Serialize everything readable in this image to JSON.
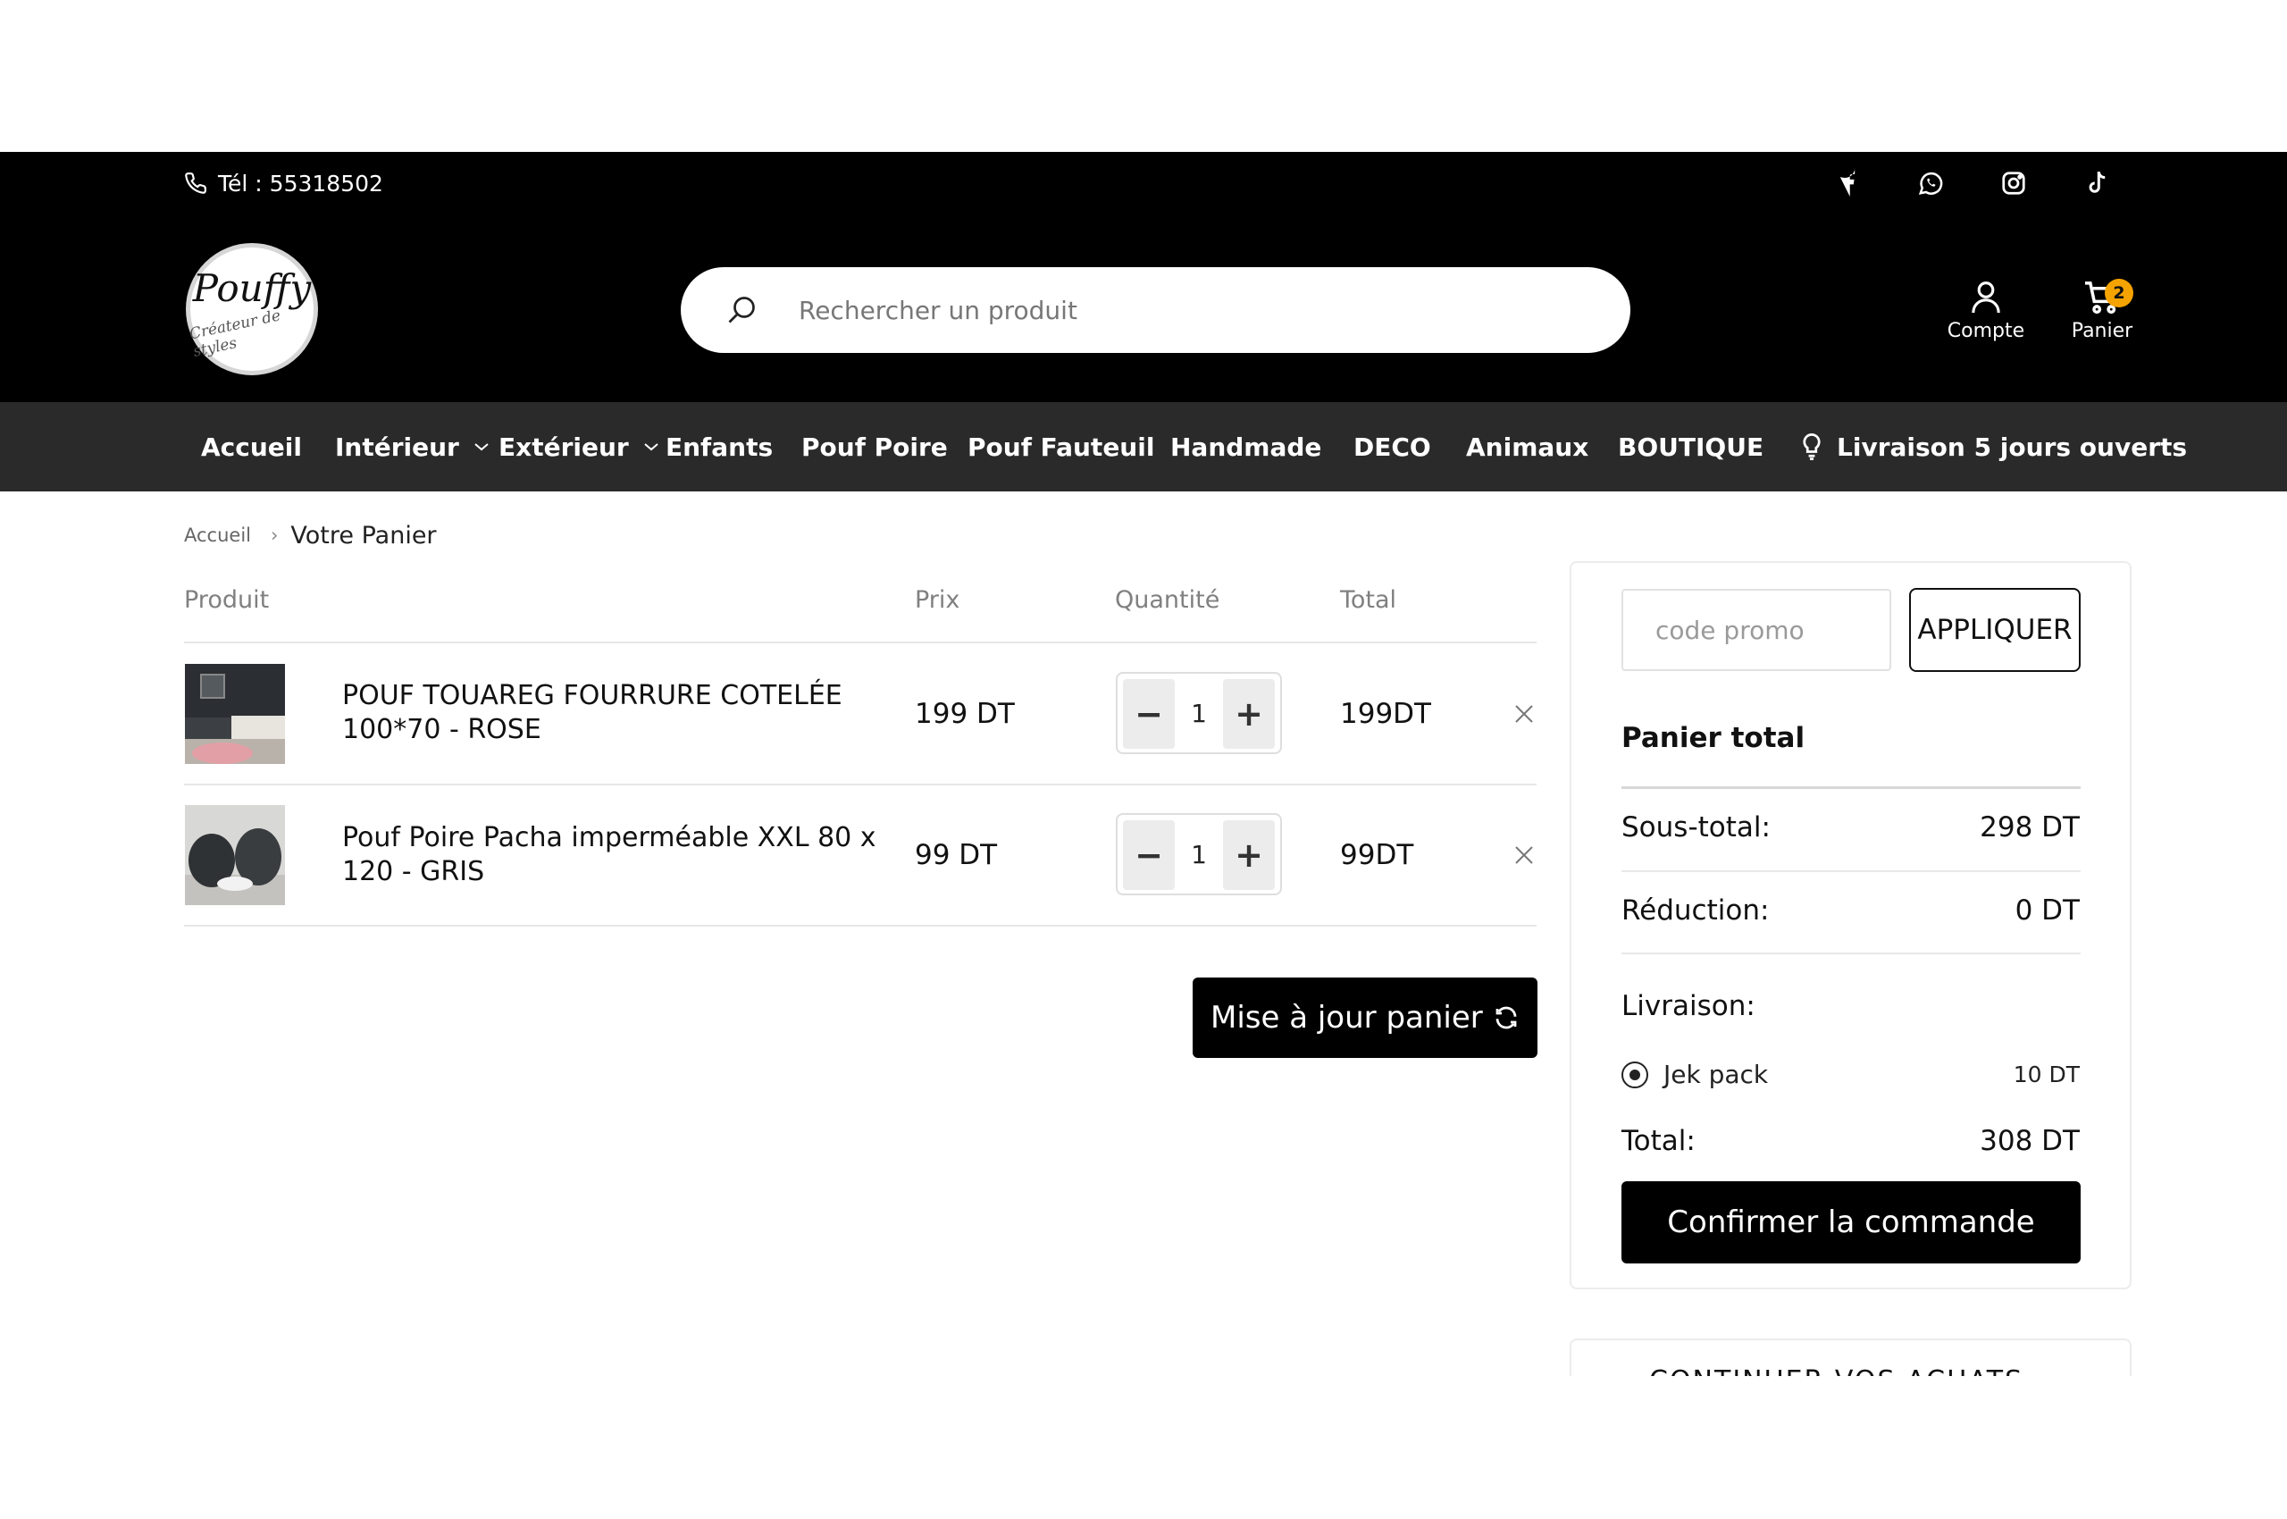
{
  "topbar": {
    "phone": "Tél : 55318502",
    "social": [
      "facebook-icon",
      "whatsapp-icon",
      "instagram-icon",
      "tiktok-icon"
    ]
  },
  "header": {
    "logo_text": "Pouffy",
    "logo_tagline": "Créateur de styles",
    "search_placeholder": "Rechercher un produit",
    "account_label": "Compte",
    "cart_label": "Panier",
    "cart_count": "2"
  },
  "nav": {
    "items": [
      {
        "label": "Accueil",
        "dropdown": false
      },
      {
        "label": "Intérieur",
        "dropdown": true
      },
      {
        "label": "Extérieur",
        "dropdown": true
      },
      {
        "label": "Enfants",
        "dropdown": false
      },
      {
        "label": "Pouf Poire",
        "dropdown": false
      },
      {
        "label": "Pouf Fauteuil",
        "dropdown": false
      },
      {
        "label": "Handmade",
        "dropdown": false
      },
      {
        "label": "DECO",
        "dropdown": false
      },
      {
        "label": "Animaux",
        "dropdown": false
      },
      {
        "label": "BOUTIQUE",
        "dropdown": false
      }
    ],
    "delivery": "Livraison 5 jours ouverts"
  },
  "breadcrumb": {
    "home": "Accueil",
    "current": "Votre Panier"
  },
  "cart": {
    "columns": {
      "product": "Produit",
      "price": "Prix",
      "quantity": "Quantité",
      "total": "Total"
    },
    "items": [
      {
        "name": "POUF TOUAREG FOURRURE COTELÉE 100*70 - ROSE",
        "price": "199 DT",
        "quantity": "1",
        "total": "199DT"
      },
      {
        "name": "Pouf Poire Pacha imperméable XXL 80 x 120 - GRIS",
        "price": "99 DT",
        "quantity": "1",
        "total": "99DT"
      }
    ],
    "update_label": "Mise à jour panier"
  },
  "summary": {
    "promo_placeholder": "code promo",
    "apply_label": "APPLIQUER",
    "title": "Panier total",
    "subtotal_label": "Sous-total:",
    "subtotal_value": "298 DT",
    "discount_label": "Réduction:",
    "discount_value": "0 DT",
    "shipping_label": "Livraison:",
    "shipping_option": "Jek pack",
    "shipping_price": "10 DT",
    "total_label": "Total:",
    "total_value": "308 DT",
    "confirm_label": "Confirmer la commande"
  },
  "continue_label": "CONTINUER VOS ACHATS"
}
